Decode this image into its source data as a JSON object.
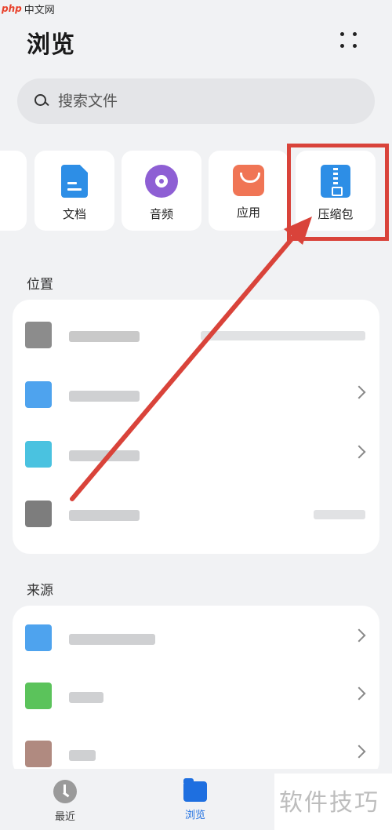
{
  "watermark": {
    "brand": "php",
    "site": "中文网",
    "footer": "软件技巧"
  },
  "header": {
    "title": "浏览",
    "more_icon": "more-dots-icon"
  },
  "search": {
    "placeholder": "搜索文件"
  },
  "categories": [
    {
      "label": "文档",
      "icon": "document-icon",
      "color": "#2d8ee6"
    },
    {
      "label": "音频",
      "icon": "audio-disc-icon",
      "color": "#8e5fd4"
    },
    {
      "label": "应用",
      "icon": "shopping-bag-icon",
      "color": "#f07555"
    },
    {
      "label": "压缩包",
      "icon": "zip-archive-icon",
      "color": "#2d8ee6",
      "highlighted": true
    }
  ],
  "sections": {
    "location_title": "位置",
    "source_title": "来源"
  },
  "tabbar": {
    "recent": "最近",
    "browse": "浏览",
    "active": "浏览",
    "accent": "#1e6fe0"
  },
  "annotation_color": "#d9433a"
}
